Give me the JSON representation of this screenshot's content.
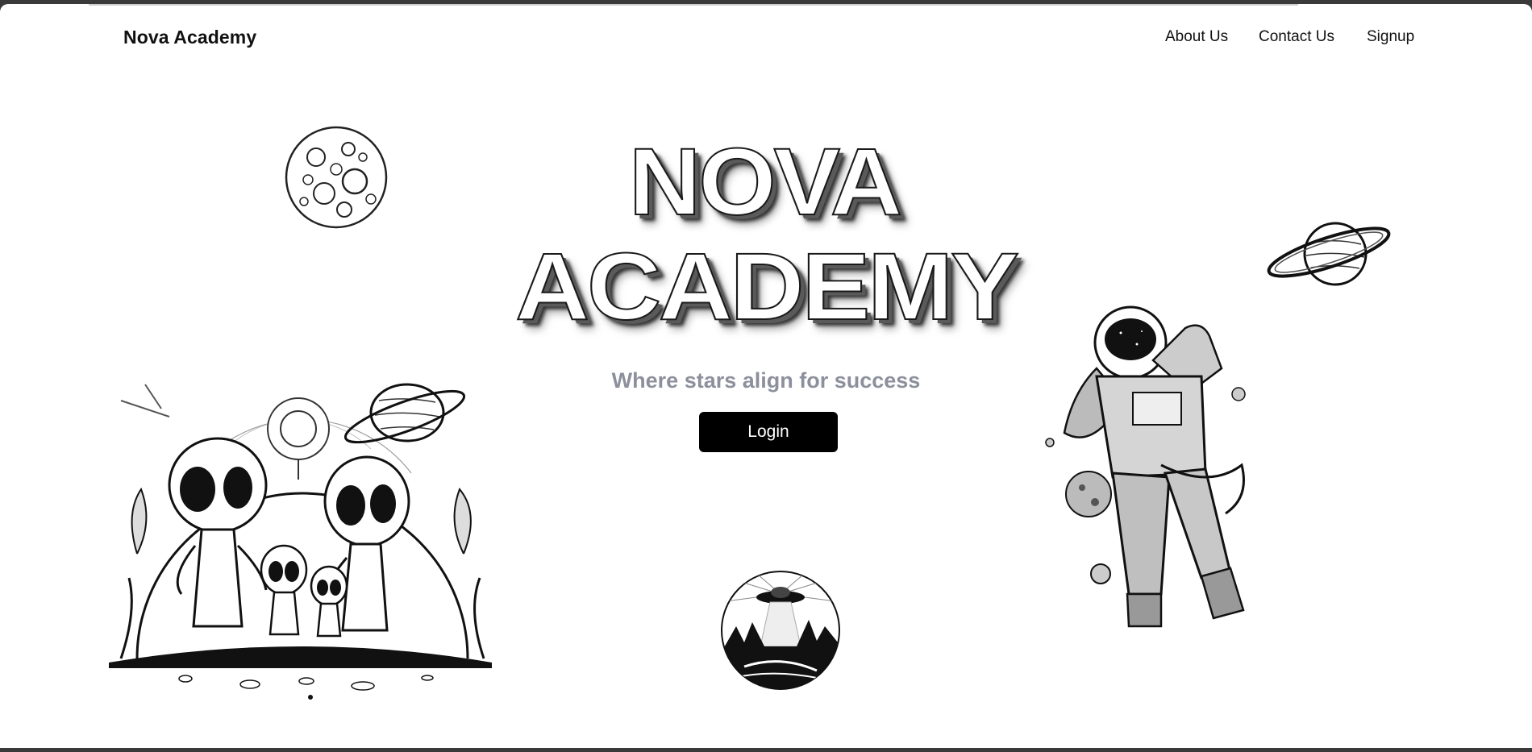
{
  "header": {
    "brand": "Nova Academy",
    "nav": [
      "About Us",
      "Contact Us",
      "Signup"
    ]
  },
  "hero": {
    "title_line1": "NOVA",
    "title_line2": "ACADEMY",
    "tagline": "Where stars align for success",
    "login_label": "Login"
  },
  "illustrations": {
    "moon": "moon-icon",
    "saturn": "saturn-planet-icon",
    "aliens": "alien-family-illustration",
    "astronaut": "astronaut-illustration",
    "ufo": "ufo-badge-illustration"
  },
  "colors": {
    "background": "#ffffff",
    "button_bg": "#000000",
    "button_text": "#ffffff",
    "tagline": "#8c909c"
  }
}
